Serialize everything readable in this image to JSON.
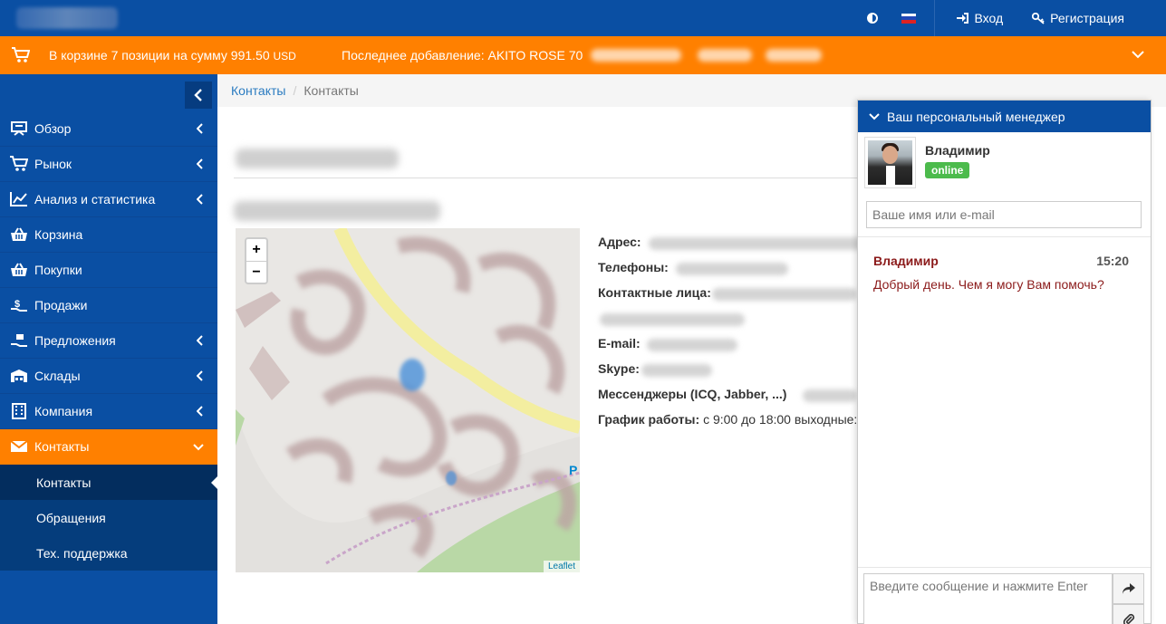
{
  "topbar": {
    "login_label": "Вход",
    "register_label": "Регистрация"
  },
  "cart": {
    "summary": "В корзине 7 позиции на сумму 991.50",
    "currency": "USD",
    "last_added": "Последнее добавление: AKITO ROSE 70"
  },
  "sidebar": {
    "items": [
      {
        "label": "Обзор",
        "icon": "overview-icon",
        "chevron": true
      },
      {
        "label": "Рынок",
        "icon": "market-cart-icon",
        "chevron": true
      },
      {
        "label": "Анализ и статистика",
        "icon": "chart-icon",
        "chevron": true
      },
      {
        "label": "Корзина",
        "icon": "basket-icon",
        "chevron": false
      },
      {
        "label": "Покупки",
        "icon": "purchases-icon",
        "chevron": false
      },
      {
        "label": "Продажи",
        "icon": "sales-icon",
        "chevron": false
      },
      {
        "label": "Предложения",
        "icon": "offers-icon",
        "chevron": true
      },
      {
        "label": "Склады",
        "icon": "warehouse-icon",
        "chevron": true
      },
      {
        "label": "Компания",
        "icon": "building-icon",
        "chevron": true
      },
      {
        "label": "Контакты",
        "icon": "envelope-icon",
        "chevron": true
      }
    ],
    "submenu": [
      "Контакты",
      "Обращения",
      "Тех. поддержка"
    ]
  },
  "breadcrumb": {
    "link": "Контакты",
    "current": "Контакты"
  },
  "map": {
    "zoom_in": "+",
    "zoom_out": "−",
    "attribution": "Leaflet"
  },
  "contact_info": {
    "address_label": "Адрес:",
    "phones_label": "Телефоны:",
    "contacts_label": "Контактные лица:",
    "email_label": "E-mail:",
    "skype_label": "Skype:",
    "messengers_label": "Мессенджеры (ICQ, Jabber, ...)",
    "schedule_label": "График работы:",
    "schedule_value": "с 9:00 до 18:00 выходные:"
  },
  "chat": {
    "header": "Ваш персональный менеджер",
    "manager_name": "Владимир",
    "status": "online",
    "name_placeholder": "Ваше имя или e-mail",
    "message": {
      "author": "Владимир",
      "time": "15:20",
      "text": "Добрый день. Чем я могу Вам помочь?"
    },
    "input_placeholder": "Введите сообщение и нажмите Enter"
  },
  "colors": {
    "primary": "#0a4fa3",
    "accent": "#ff8000",
    "online": "#4cbb4c",
    "message": "#8b1a1a"
  }
}
